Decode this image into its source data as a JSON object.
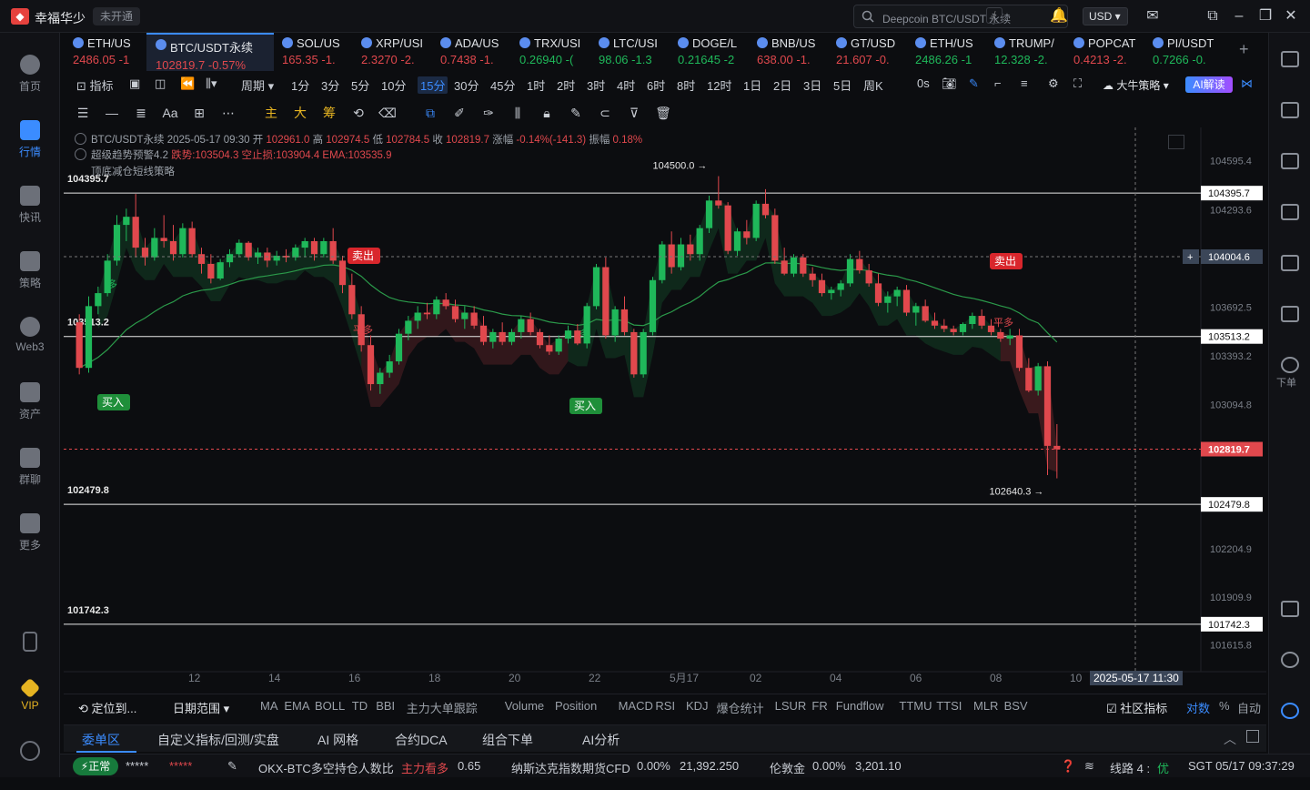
{
  "app": {
    "name": "幸福华少",
    "account_badge": "未开通"
  },
  "search": {
    "placeholder": "Deepcoin BTC/USDT 永续",
    "shortcut": "/"
  },
  "currency": "USD",
  "sidebar": [
    {
      "label": "首页",
      "icon": "home-icon"
    },
    {
      "label": "行情",
      "icon": "market-chart-icon",
      "active": true
    },
    {
      "label": "快讯",
      "icon": "news-icon"
    },
    {
      "label": "策略",
      "icon": "strategy-robot-icon"
    },
    {
      "label": "Web3",
      "icon": "web3-icon"
    },
    {
      "label": "资产",
      "icon": "wallet-icon"
    },
    {
      "label": "群聊",
      "icon": "chat-icon"
    },
    {
      "label": "更多",
      "icon": "more-grid-icon"
    },
    {
      "label": "",
      "icon": "phone-icon"
    },
    {
      "label": "VIP",
      "icon": "vip-diamond-icon"
    },
    {
      "label": "",
      "icon": "settings-icon"
    }
  ],
  "tickers": [
    {
      "symbol": "ETH/US",
      "price": "2486.05",
      "change": "-1",
      "dir": "down"
    },
    {
      "symbol": "BTC/USDT永续",
      "price": "102819.7",
      "change": "-0.57%",
      "dir": "down",
      "active": true
    },
    {
      "symbol": "SOL/US",
      "price": "165.35",
      "change": "-1.",
      "dir": "down"
    },
    {
      "symbol": "XRP/USI",
      "price": "2.3270",
      "change": "-2.",
      "dir": "down"
    },
    {
      "symbol": "ADA/US",
      "price": "0.7438",
      "change": "-1.",
      "dir": "down"
    },
    {
      "symbol": "TRX/USI",
      "price": "0.26940",
      "change": "-(",
      "dir": "up"
    },
    {
      "symbol": "LTC/USI",
      "price": "98.06",
      "change": "-1.3",
      "dir": "up"
    },
    {
      "symbol": "DOGE/L",
      "price": "0.21645",
      "change": "-2",
      "dir": "up"
    },
    {
      "symbol": "BNB/US",
      "price": "638.00",
      "change": "-1.",
      "dir": "down"
    },
    {
      "symbol": "GT/USD",
      "price": "21.607",
      "change": "-0.",
      "dir": "down"
    },
    {
      "symbol": "ETH/US",
      "price": "2486.26",
      "change": "-1",
      "dir": "up"
    },
    {
      "symbol": "TRUMP/",
      "price": "12.328",
      "change": "-2.",
      "dir": "up"
    },
    {
      "symbol": "POPCAT",
      "price": "0.4213",
      "change": "-2.",
      "dir": "down"
    },
    {
      "symbol": "PI/USDT",
      "price": "0.7266",
      "change": "-0.",
      "dir": "up"
    }
  ],
  "timeframes": [
    "1分",
    "3分",
    "5分",
    "10分",
    "15分",
    "30分",
    "45分",
    "1时",
    "2时",
    "3时",
    "4时",
    "6时",
    "8时",
    "12时",
    "1日",
    "2日",
    "3日",
    "5日",
    "周K"
  ],
  "active_timeframe": "15分",
  "toolbar": {
    "indicator": "指标",
    "period": "周期",
    "seconds": "0s",
    "bull_strategy": "大牛策略",
    "ai": "AI解读"
  },
  "draw_tools": {
    "main": "主",
    "big": "大",
    "chip": "筹",
    "font": "Aa"
  },
  "chart_info": {
    "line1_prefix": "BTC/USDT永续  2025-05-17 09:30  开",
    "open": "102961.0",
    "high_lbl": "高",
    "high": "102974.5",
    "low_lbl": "低",
    "low": "102784.5",
    "close_lbl": "收",
    "close": "102819.7",
    "change_lbl": "涨幅",
    "change": "-0.14%(-141.3)",
    "amp_lbl": "振幅",
    "amp": "0.18%",
    "line2_name": "超级趋势预警4.2",
    "line2_vals": "跌势:103504.3  空止损:103904.4  EMA:103535.9",
    "line3": "顶底减仓短线策略"
  },
  "chart_data": {
    "type": "candlestick",
    "symbol": "BTC/USDT永续",
    "interval": "15分",
    "y_ticks": [
      104595.4,
      104293.6,
      103692.5,
      103393.2,
      103094.8,
      102204.9,
      101909.9,
      101615.8
    ],
    "x_ticks": [
      "12",
      "14",
      "16",
      "18",
      "20",
      "22",
      "5月17",
      "02",
      "04",
      "06",
      "08",
      "10"
    ],
    "ylim": [
      101450,
      104800
    ],
    "horizontal_levels": [
      104395.7,
      103513.2,
      102479.8,
      101742.3
    ],
    "current_price": 102819.7,
    "crosshair_price": 104004.6,
    "crosshair_time": "2025-05-17 11:30",
    "high_marker": {
      "label": "104500.0 →",
      "value": 104500.0
    },
    "low_marker": {
      "label": "102640.3 →",
      "value": 102640.3
    },
    "signals": [
      {
        "type": "卖出",
        "side": "sell"
      },
      {
        "type": "卖出",
        "side": "sell"
      },
      {
        "type": "买入",
        "side": "buy"
      },
      {
        "type": "买入",
        "side": "buy"
      }
    ],
    "annotations": [
      "多",
      "平多",
      "多",
      "平多"
    ],
    "candles": [
      [
        103600,
        103650,
        103280,
        103320
      ],
      [
        103320,
        103760,
        103290,
        103700
      ],
      [
        103700,
        103820,
        103650,
        103780
      ],
      [
        103780,
        104020,
        103760,
        103980
      ],
      [
        103980,
        104260,
        103950,
        104200
      ],
      [
        104200,
        104300,
        104100,
        104250
      ],
      [
        104250,
        104390,
        104000,
        104060
      ],
      [
        104060,
        104120,
        103950,
        104000
      ],
      [
        104000,
        104180,
        103980,
        104120
      ],
      [
        104120,
        104260,
        104060,
        104100
      ],
      [
        104100,
        104200,
        103980,
        104020
      ],
      [
        104020,
        104210,
        104000,
        104180
      ],
      [
        104180,
        104220,
        104000,
        104020
      ],
      [
        104020,
        104060,
        103900,
        103960
      ],
      [
        103960,
        104020,
        103840,
        103870
      ],
      [
        103870,
        103990,
        103860,
        103970
      ],
      [
        103970,
        104050,
        103940,
        104020
      ],
      [
        104020,
        104110,
        104000,
        104090
      ],
      [
        104090,
        104100,
        103980,
        104000
      ],
      [
        104000,
        104060,
        103960,
        104030
      ],
      [
        104030,
        104060,
        103940,
        103980
      ],
      [
        103980,
        104040,
        103950,
        104010
      ],
      [
        104010,
        104050,
        103970,
        104000
      ],
      [
        104000,
        104080,
        103980,
        104060
      ],
      [
        104060,
        104120,
        104000,
        104100
      ],
      [
        104100,
        104120,
        103980,
        104020
      ],
      [
        104020,
        104120,
        104000,
        104100
      ],
      [
        104100,
        104180,
        103960,
        103980
      ],
      [
        103980,
        104010,
        103780,
        103830
      ],
      [
        103830,
        103900,
        103620,
        103650
      ],
      [
        103650,
        103700,
        103420,
        103460
      ],
      [
        103460,
        103520,
        103180,
        103220
      ],
      [
        103220,
        103320,
        103160,
        103290
      ],
      [
        103290,
        103400,
        103260,
        103360
      ],
      [
        103360,
        103560,
        103340,
        103530
      ],
      [
        103530,
        103640,
        103490,
        103610
      ],
      [
        103610,
        103700,
        103560,
        103660
      ],
      [
        103660,
        103720,
        103620,
        103650
      ],
      [
        103650,
        103760,
        103620,
        103740
      ],
      [
        103740,
        103780,
        103680,
        103700
      ],
      [
        103700,
        103740,
        103600,
        103620
      ],
      [
        103620,
        103700,
        103560,
        103660
      ],
      [
        103660,
        103700,
        103560,
        103580
      ],
      [
        103580,
        103640,
        103460,
        103480
      ],
      [
        103480,
        103560,
        103440,
        103540
      ],
      [
        103540,
        103600,
        103460,
        103480
      ],
      [
        103480,
        103560,
        103460,
        103540
      ],
      [
        103540,
        103640,
        103500,
        103620
      ],
      [
        103620,
        103660,
        103520,
        103540
      ],
      [
        103540,
        103560,
        103440,
        103460
      ],
      [
        103460,
        103520,
        103400,
        103420
      ],
      [
        103420,
        103520,
        103400,
        103500
      ],
      [
        103500,
        103580,
        103470,
        103550
      ],
      [
        103550,
        103590,
        103460,
        103470
      ],
      [
        103470,
        103720,
        103440,
        103700
      ],
      [
        103700,
        103960,
        103680,
        103940
      ],
      [
        103940,
        104000,
        103500,
        103520
      ],
      [
        103520,
        103700,
        103480,
        103680
      ],
      [
        103680,
        103760,
        103520,
        103540
      ],
      [
        103540,
        103560,
        103260,
        103280
      ],
      [
        103280,
        103560,
        103260,
        103540
      ],
      [
        103540,
        103880,
        103520,
        103860
      ],
      [
        103860,
        104100,
        103840,
        104080
      ],
      [
        104080,
        104160,
        103900,
        103940
      ],
      [
        103940,
        104120,
        103920,
        104080
      ],
      [
        104080,
        104140,
        103980,
        104020
      ],
      [
        104020,
        104200,
        103980,
        104180
      ],
      [
        104180,
        104380,
        104150,
        104350
      ],
      [
        104350,
        104500,
        104300,
        104320
      ],
      [
        104320,
        104340,
        104020,
        104040
      ],
      [
        104040,
        104180,
        104010,
        104160
      ],
      [
        104160,
        104230,
        104080,
        104120
      ],
      [
        104120,
        104350,
        104100,
        104330
      ],
      [
        104330,
        104420,
        104240,
        104260
      ],
      [
        104260,
        104300,
        103960,
        103980
      ],
      [
        103980,
        104060,
        103890,
        103900
      ],
      [
        103900,
        104020,
        103880,
        104000
      ],
      [
        104000,
        104020,
        103880,
        103900
      ],
      [
        103900,
        103940,
        103820,
        103860
      ],
      [
        103860,
        103900,
        103760,
        103780
      ],
      [
        103780,
        103820,
        103740,
        103800
      ],
      [
        103800,
        103860,
        103760,
        103840
      ],
      [
        103840,
        104020,
        103820,
        103990
      ],
      [
        103990,
        104040,
        103900,
        103920
      ],
      [
        103920,
        103960,
        103820,
        103840
      ],
      [
        103840,
        103900,
        103700,
        103720
      ],
      [
        103720,
        103790,
        103660,
        103760
      ],
      [
        103760,
        103820,
        103700,
        103800
      ],
      [
        103800,
        103830,
        103640,
        103660
      ],
      [
        103660,
        103720,
        103580,
        103700
      ],
      [
        103700,
        103740,
        103600,
        103610
      ],
      [
        103610,
        103660,
        103560,
        103580
      ],
      [
        103580,
        103620,
        103540,
        103560
      ],
      [
        103560,
        103580,
        103520,
        103540
      ],
      [
        103540,
        103600,
        103520,
        103590
      ],
      [
        103590,
        103660,
        103560,
        103640
      ],
      [
        103640,
        103680,
        103560,
        103580
      ],
      [
        103580,
        103620,
        103520,
        103540
      ],
      [
        103540,
        103560,
        103480,
        103500
      ],
      [
        103500,
        103560,
        103460,
        103520
      ],
      [
        103520,
        103560,
        103300,
        103320
      ],
      [
        103320,
        103380,
        103170,
        103180
      ],
      [
        103180,
        103350,
        103150,
        103330
      ],
      [
        103330,
        103360,
        102660,
        102840
      ],
      [
        102840,
        102974,
        102640,
        102819
      ]
    ]
  },
  "price_axis_labels": {
    "level_1": "104395.7",
    "level_2": "103513.2",
    "level_3": "102479.8",
    "level_4": "101742.3",
    "crosshair": "104004.6",
    "current": "102819.7"
  },
  "indicator_bar": {
    "locate": "定位到...",
    "date_range": "日期范围",
    "items": [
      "MA",
      "EMA",
      "BOLL",
      "TD",
      "BBI",
      "主力大单跟踪",
      "Volume",
      "Position",
      "MACD",
      "RSI",
      "KDJ",
      "爆仓统计",
      "LSUR",
      "FR",
      "Fundflow",
      "TTMU",
      "TTSI",
      "MLR",
      "BSV"
    ],
    "community": "社区指标",
    "log": "对数",
    "pct": "%",
    "auto": "自动"
  },
  "order_tabs": [
    "委单区",
    "自定义指标/回测/实盘",
    "AI 网格",
    "合约DCA",
    "组合下单",
    "AI分析"
  ],
  "status_bar": {
    "status": "正常",
    "account_mask": "*****",
    "ratio_label": "OKX-BTC多空持仓人数比",
    "ratio_signal": "主力看多",
    "ratio_value": "0.65",
    "nasdaq_label": "纳斯达克指数期货CFD",
    "nasdaq_change": "0.00%",
    "nasdaq_value": "21,392.250",
    "gold_label": "伦敦金",
    "gold_change": "0.00%",
    "gold_value": "3,201.10",
    "line_label": "线路 4 :",
    "line_quality": "优",
    "clock": "SGT  05/17 09:37:29"
  },
  "right_rail": {
    "order_label": "下单"
  },
  "colors": {
    "up": "#1fb85a",
    "down": "#e0484d",
    "accent": "#3b8cff",
    "bg": "#0c0d10"
  }
}
